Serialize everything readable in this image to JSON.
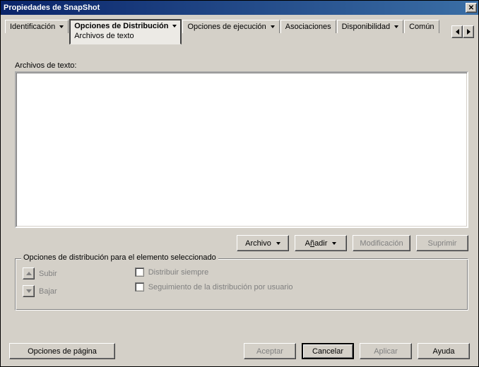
{
  "title": "Propiedades de SnapShot",
  "tabs": {
    "ident": "Identificación",
    "dist": "Opciones de Distribución",
    "dist_sub": "Archivos de texto",
    "ejec": "Opciones de ejecución",
    "asoc": "Asociaciones",
    "disp": "Disponibilidad",
    "comun": "Común"
  },
  "main": {
    "list_label": "Archivos de texto:",
    "archivo": "Archivo",
    "anadir_pre": "A",
    "anadir_ul": "ñ",
    "anadir_post": "adir",
    "modif": "Modificación",
    "suprimir": "Suprimir"
  },
  "group": {
    "title": "Opciones de distribución para el elemento seleccionado",
    "subir": "Subir",
    "bajar": "Bajar",
    "chk1": "Distribuir siempre",
    "chk2": "Seguimiento de la distribución por usuario"
  },
  "footer": {
    "opciones": "Opciones de página",
    "aceptar": "Aceptar",
    "cancelar": "Cancelar",
    "aplicar": "Aplicar",
    "ayuda": "Ayuda"
  }
}
